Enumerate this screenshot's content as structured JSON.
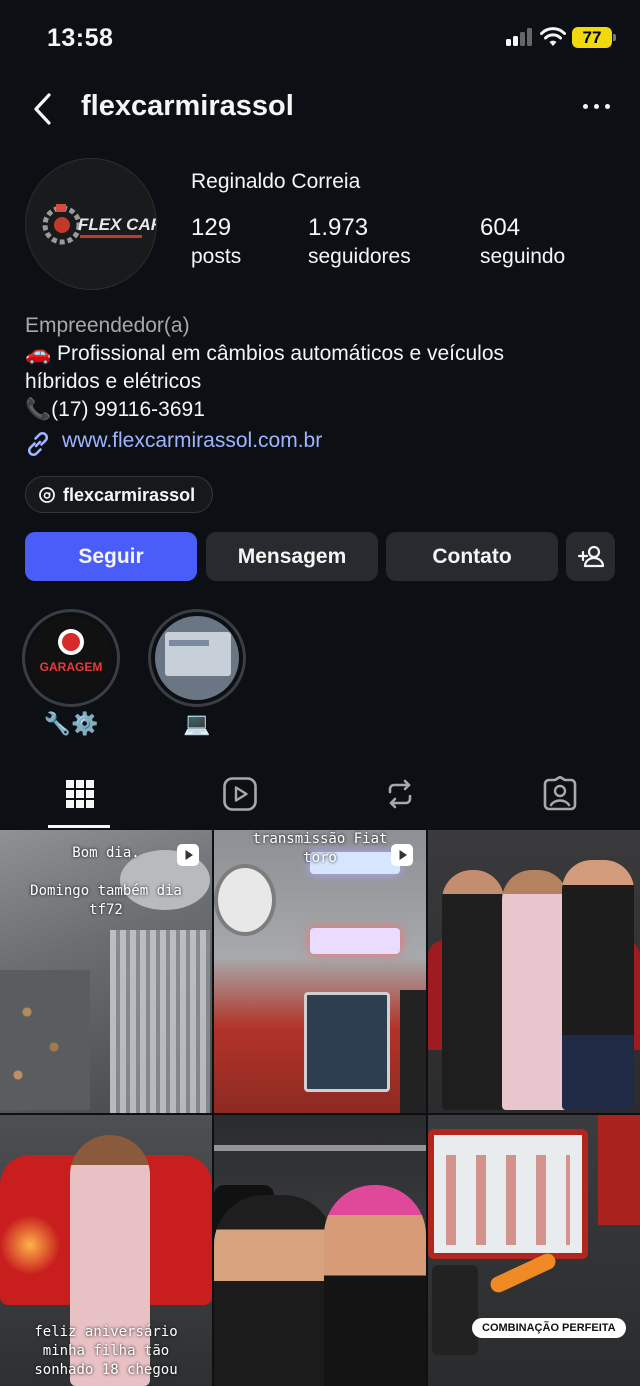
{
  "status_bar": {
    "time": "13:58",
    "battery": "77"
  },
  "header": {
    "username": "flexcarmirassol"
  },
  "profile": {
    "display_name": "Reginaldo Correia",
    "avatar_logo_text": "FLEX CAR",
    "stats": [
      {
        "value": "129",
        "label": "posts"
      },
      {
        "value": "1.973",
        "label": "seguidores"
      },
      {
        "value": "604",
        "label": "seguindo"
      }
    ],
    "category": "Empreendedor(a)",
    "bio_lines": [
      "🚗 Profissional em câmbios automáticos e veículos",
      "híbridos e elétricos",
      "📞(17) 99116-3691"
    ],
    "link": "www.flexcarmirassol.com.br",
    "threads_handle": "flexcarmirassol"
  },
  "buttons": {
    "follow": "Seguir",
    "message": "Mensagem",
    "contact": "Contato"
  },
  "highlights": [
    {
      "label": "🔧⚙️",
      "cover_text": "GARAGEM"
    },
    {
      "label": "💻"
    }
  ],
  "posts": [
    {
      "caption_lines": [
        "Bom dia.",
        "",
        "Domingo também dia",
        "tf72"
      ],
      "is_reel": true
    },
    {
      "caption_lines": [
        "transmissão Fiat",
        "toro"
      ],
      "is_reel": true
    },
    {
      "caption_lines": [],
      "is_reel": false
    },
    {
      "caption_lines": [
        "feliz aniversário",
        "minha filha tão",
        "sonhado 18 chegou"
      ],
      "is_reel": false
    },
    {
      "caption_lines": [],
      "is_reel": false
    },
    {
      "caption_lines": [],
      "badge": "COMBINAÇÃO PERFEITA",
      "is_reel": false
    }
  ],
  "colors": {
    "background": "#0c1014",
    "primary_button": "#4a5df9",
    "secondary_button": "#272a2e",
    "link": "#a0b4ff",
    "battery": "#f2d90b"
  }
}
